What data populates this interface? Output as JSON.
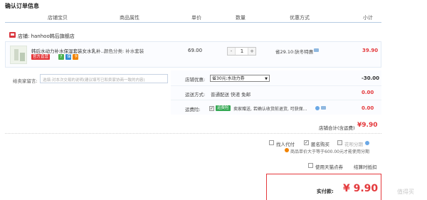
{
  "page": {
    "title": "确认订单信息"
  },
  "columns": [
    "店铺宝贝",
    "商品属性",
    "单价",
    "数量",
    "优惠方式",
    "小计"
  ],
  "shop": {
    "label": "店铺: hanhoo韩后旗舰店"
  },
  "item": {
    "title": "韩后水动力补水保湿套装女水乳补...",
    "tags": [
      "官方直营",
      "7",
      "保",
      "卡"
    ],
    "attr": "颜色分类: 补水套装",
    "unit_price": "69.00",
    "quantity": "1",
    "minus": "-",
    "plus": "+",
    "promo": "省29.10:狄冬特惠",
    "subtotal": "39.90"
  },
  "message": {
    "label": "给卖家留言:",
    "placeholder": "选填:对本次交易的说明(建议填写已和卖家协商一致的内容)"
  },
  "coupon": {
    "label": "店铺优惠:",
    "selected": "省30元:水动力券",
    "amount": "-30.00"
  },
  "shipping": {
    "label": "运送方式:",
    "value": "普通配送 快递 免邮",
    "amount": "0.00"
  },
  "insurance": {
    "label": "运费险:",
    "badge": "运费险",
    "text": "卖家赠送, 若确认收货前退货, 可获保...",
    "amount": "0.00"
  },
  "shop_total": {
    "label": "店铺合计(含运费)",
    "value": "¥9.90"
  },
  "options": {
    "proxy": "找人代付",
    "anonymous": "匿名购买",
    "installment": "花呗分期",
    "installment_note": "商品单价大于等于600.00元才能使用分期",
    "tmall_points": "使用天猫点券",
    "points_link": "结算时抵扣"
  },
  "payment": {
    "label": "实付款:",
    "value": "¥ 9.90"
  },
  "watermark": "值得买"
}
